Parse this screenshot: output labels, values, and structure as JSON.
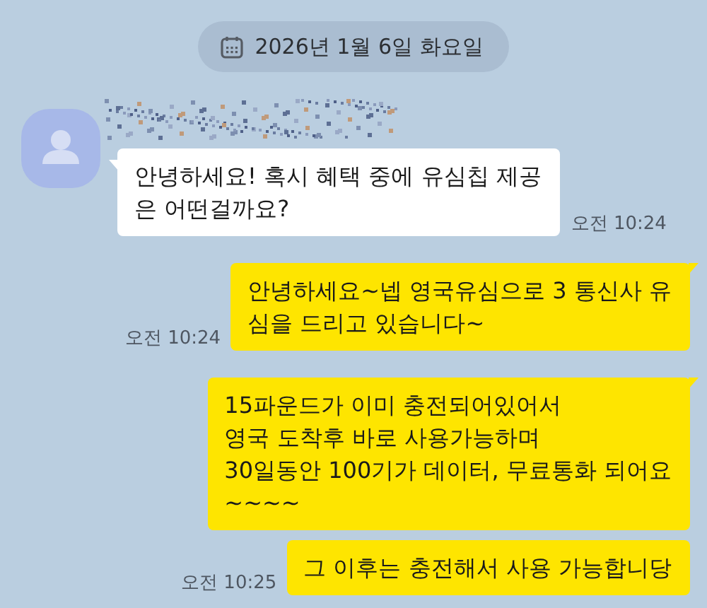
{
  "date_divider": {
    "label": "2026년 1월 6일 화요일"
  },
  "messages": [
    {
      "kind": "incoming",
      "sender_hidden": true,
      "tail": true,
      "lines": [
        "안녕하세요! 혹시 혜택 중에 유심칩 제공",
        "은 어떤걸까요?"
      ],
      "time": "오전 10:24"
    },
    {
      "kind": "outgoing",
      "tail": true,
      "lines": [
        "안녕하세요~넵 영국유심으로 3 통신사 유",
        "심을 드리고 있습니다~"
      ],
      "time": "오전 10:24"
    },
    {
      "kind": "outgoing",
      "tail": true,
      "lines": [
        "15파운드가 이미 충전되어있어서",
        "영국 도착후 바로 사용가능하며",
        "30일동안 100기가 데이터, 무료통화 되어요",
        "~~~~"
      ]
    },
    {
      "kind": "outgoing",
      "tail": false,
      "lines": [
        "그 이후는 충전해서 사용 가능합니당"
      ],
      "time": "오전 10:25"
    }
  ]
}
